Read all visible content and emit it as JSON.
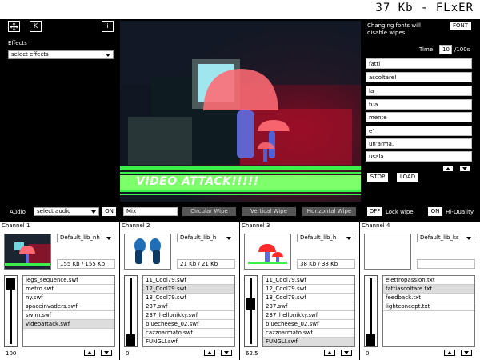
{
  "app": {
    "title": "37 Kb - FLxER"
  },
  "toolbar": {
    "move_icon": "move-icon",
    "k_label": "K",
    "info_label": "i"
  },
  "effects": {
    "label": "Effects",
    "select_value": "select effects"
  },
  "video": {
    "banner_text": "VIDEO ATTACK!!!!!"
  },
  "right_panel": {
    "notice": "Changing fonts will disable wipes",
    "font_button": "FONT",
    "time_label": "Time:",
    "time_value": "10",
    "time_unit": "/100s",
    "lines": [
      "fatti",
      "ascoltare!",
      "la",
      "tua",
      "mente",
      "e'",
      "un'arma,",
      "usala"
    ],
    "stop_button": "STOP",
    "load_button": "LOAD"
  },
  "controls": {
    "audio_label": "Audio",
    "audio_select": "select audio",
    "audio_on": "ON",
    "mix_value": "Mix",
    "circular_wipe": "Circular Wipe",
    "vertical_wipe": "Vertical Wipe",
    "horizontal_wipe": "Horizontal Wipe",
    "lock_off": "OFF",
    "lock_label": "Lock wipe",
    "hq_on": "ON",
    "hq_label": "Hi-Quality"
  },
  "channels": [
    {
      "name": "Channel 1",
      "library": "Default_lib_nh",
      "size": "155 Kb / 155 Kb",
      "files": [
        "legs_sequence.swf",
        "metro.swf",
        "ny.swf",
        "spaceinvaders.swf",
        "swim.swf",
        "videoattack.swf"
      ],
      "selected": 5,
      "level": "100",
      "level_fraction": 0.0
    },
    {
      "name": "Channel 2",
      "library": "Default_lib_h",
      "size": "21 Kb / 21 Kb",
      "files": [
        "11_Cool79.swf",
        "12_Cool79.swf",
        "13_Cool79.swf",
        "237.swf",
        "237_hellonikky.swf",
        "bluecheese_02.swf",
        "cazzoarmato.swf",
        "FUNGLI.swf"
      ],
      "selected": 1,
      "level": "0",
      "level_fraction": 1.0
    },
    {
      "name": "Channel 3",
      "library": "Default_lib_h",
      "size": "38 Kb / 38 Kb",
      "files": [
        "11_Cool79.swf",
        "12_Cool79.swf",
        "13_Cool79.swf",
        "237.swf",
        "237_hellonikky.swf",
        "bluecheese_02.swf",
        "cazzoarmato.swf",
        "FUNGLI.swf"
      ],
      "selected": 7,
      "level": "62.5",
      "level_fraction": 0.375
    },
    {
      "name": "Channel 4",
      "library": "Default_lib_ks",
      "size": "",
      "files": [
        "elettropassion.txt",
        "fattiascoltare.txt",
        "feedback.txt",
        "lightconcept.txt"
      ],
      "selected": 1,
      "level": "0",
      "level_fraction": 1.0
    }
  ]
}
